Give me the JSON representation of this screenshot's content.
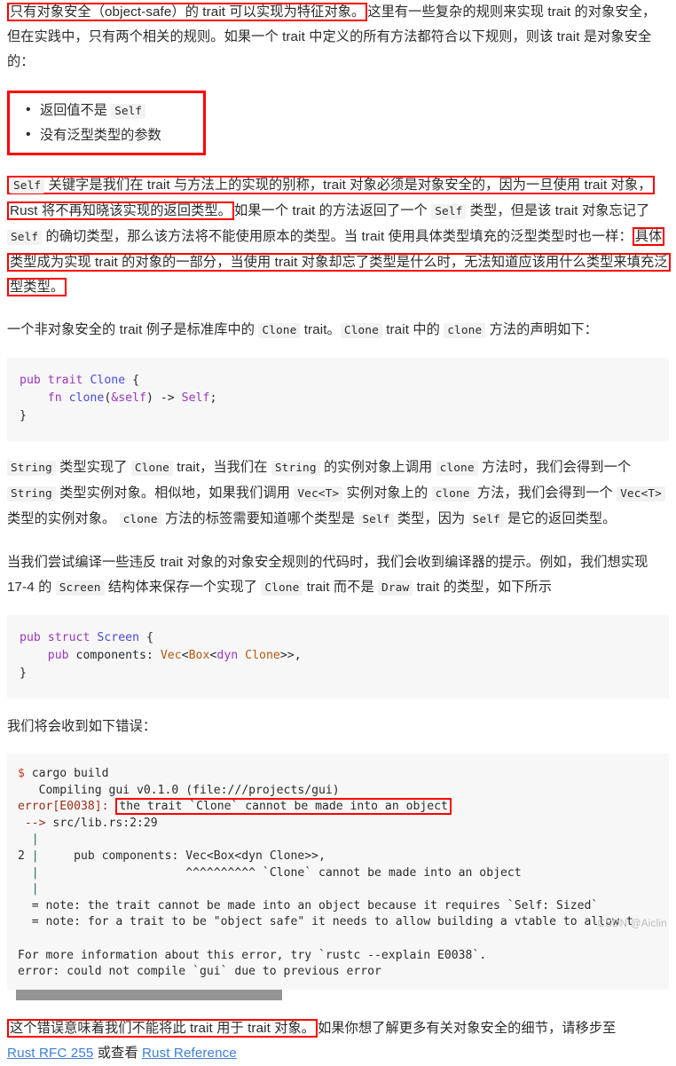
{
  "article": {
    "para1": {
      "highlighted": "只有对象安全（object-safe）的 trait 可以实现为特征对象。",
      "rest": "这里有一些复杂的规则来实现 trait 的对象安全，但在实践中，只有两个相关的规则。如果一个 trait 中定义的所有方法都符合以下规则，则该 trait 是对象安全的："
    },
    "rules": [
      {
        "before": "返回值不是 ",
        "code": "Self",
        "after": ""
      },
      {
        "before": "没有泛型类型的参数",
        "code": "",
        "after": ""
      }
    ],
    "para2": {
      "seg1_code": "Self",
      "seg1": " 关键字是我们在 trait 与方法上的实现的别称，trait 对象必须是对象安全的，因为一旦使用 trait 对象，Rust 将不再知晓该实现的返回类型。",
      "seg2_a": "如果一个 trait 的方法返回了一个 ",
      "seg2_code1": "Self",
      "seg2_b": " 类型，但是该 trait 对象忘记了 ",
      "seg2_code2": "Self",
      "seg2_c": " 的确切类型，那么该方法将不能使用原本的类型。当 trait 使用具体类型填充的泛型类型时也一样：",
      "seg3": "具体类型成为实现 trait 的对象的一部分，当使用 trait 对象却忘了类型是什么时，无法知道应该用什么类型来填充泛型类型。"
    },
    "para3": {
      "a": "一个非对象安全的 trait 例子是标准库中的 ",
      "code1": "Clone",
      "b": " trait。",
      "code2": "Clone",
      "c": " trait 中的 ",
      "code3": "clone",
      "d": " 方法的声明如下："
    },
    "code_clone": {
      "lines": [
        [
          {
            "t": "pub",
            "c": "k-purple"
          },
          {
            "t": " ",
            "c": "k-plain"
          },
          {
            "t": "trait",
            "c": "k-purple"
          },
          {
            "t": " ",
            "c": "k-plain"
          },
          {
            "t": "Clone",
            "c": "k-blue"
          },
          {
            "t": " {",
            "c": "k-plain"
          }
        ],
        [
          {
            "t": "    ",
            "c": "k-plain"
          },
          {
            "t": "fn",
            "c": "k-purple"
          },
          {
            "t": " ",
            "c": "k-plain"
          },
          {
            "t": "clone",
            "c": "k-blue"
          },
          {
            "t": "(",
            "c": "k-plain"
          },
          {
            "t": "&self",
            "c": "k-purple"
          },
          {
            "t": ") -> ",
            "c": "k-plain"
          },
          {
            "t": "Self",
            "c": "k-purple"
          },
          {
            "t": ";",
            "c": "k-plain"
          }
        ],
        [
          {
            "t": "}",
            "c": "k-plain"
          }
        ]
      ]
    },
    "para4": {
      "c1": "String",
      "a": " 类型实现了 ",
      "c2": "Clone",
      "b": " trait，当我们在 ",
      "c3": "String",
      "c": " 的实例对象上调用 ",
      "c4": "clone",
      "d": " 方法时，我们会得到一个 ",
      "c5": "String",
      "e": " 类型实例对象。相似地，如果我们调用 ",
      "c6": "Vec<T>",
      "f": " 实例对象上的 ",
      "c7": "clone",
      "g": " 方法，我们会得到一个 ",
      "c8": "Vec<T>",
      "h": " 类型的实例对象。 ",
      "c9": "clone",
      "i": " 方法的标签需要知道哪个类型是 ",
      "c10": "Self",
      "j": " 类型，因为 ",
      "c11": "Self",
      "k": " 是它的返回类型。"
    },
    "para5": {
      "a": "当我们尝试编译一些违反 trait 对象的对象安全规则的代码时，我们会收到编译器的提示。例如，我们想实现 17-4 的 ",
      "c1": "Screen",
      "b": " 结构体来保存一个实现了 ",
      "c2": "Clone",
      "c": " trait 而不是 ",
      "c3": "Draw",
      "d": " trait 的类型，如下所示"
    },
    "code_screen": {
      "lines": [
        [
          {
            "t": "pub",
            "c": "k-purple"
          },
          {
            "t": " ",
            "c": "k-plain"
          },
          {
            "t": "struct",
            "c": "k-purple"
          },
          {
            "t": " ",
            "c": "k-plain"
          },
          {
            "t": "Screen",
            "c": "k-blue"
          },
          {
            "t": " {",
            "c": "k-plain"
          }
        ],
        [
          {
            "t": "    ",
            "c": "k-plain"
          },
          {
            "t": "pub",
            "c": "k-purple"
          },
          {
            "t": " components: ",
            "c": "k-plain"
          },
          {
            "t": "Vec",
            "c": "k-orange"
          },
          {
            "t": "<",
            "c": "k-plain"
          },
          {
            "t": "Box",
            "c": "k-orange"
          },
          {
            "t": "<",
            "c": "k-plain"
          },
          {
            "t": "dyn",
            "c": "k-purple"
          },
          {
            "t": " ",
            "c": "k-plain"
          },
          {
            "t": "Clone",
            "c": "k-orange"
          },
          {
            "t": ">>,",
            "c": "k-plain"
          }
        ],
        [
          {
            "t": "}",
            "c": "k-plain"
          }
        ]
      ]
    },
    "para6": "我们将会收到如下错误：",
    "terminal": {
      "lines": [
        [
          {
            "t": "$",
            "c": "t-red"
          },
          {
            "t": " cargo build",
            "c": "t-plain"
          }
        ],
        [
          {
            "t": "   Compiling gui v0.1.0 (file:///projects/gui)",
            "c": "t-plain"
          }
        ],
        [
          {
            "t": "error[E0038]:",
            "c": "t-maroon"
          },
          {
            "t": " ",
            "c": "t-plain"
          },
          {
            "t": "the trait `Clone` cannot be made into an object",
            "c": "t-plain",
            "hl": true
          }
        ],
        [
          {
            "t": " ",
            "c": "t-plain"
          },
          {
            "t": "-->",
            "c": "t-maroon"
          },
          {
            "t": " src/lib.rs:2:29",
            "c": "t-plain"
          }
        ],
        [
          {
            "t": "  ",
            "c": "t-plain"
          },
          {
            "t": "|",
            "c": "t-teal"
          }
        ],
        [
          {
            "t": "2 ",
            "c": "t-plain"
          },
          {
            "t": "|",
            "c": "t-teal"
          },
          {
            "t": "     pub components: Vec<Box<dyn Clone>>,",
            "c": "t-plain"
          }
        ],
        [
          {
            "t": "  ",
            "c": "t-plain"
          },
          {
            "t": "|",
            "c": "t-teal"
          },
          {
            "t": "                     ^^^^^^^^^^ `Clone` cannot be made into an object",
            "c": "t-plain"
          }
        ],
        [
          {
            "t": "  ",
            "c": "t-plain"
          },
          {
            "t": "|",
            "c": "t-teal"
          }
        ],
        [
          {
            "t": "  = note: the trait cannot be made into an object because it requires `Self: Sized`",
            "c": "t-plain"
          }
        ],
        [
          {
            "t": "  = note: for a trait to be \"object safe\" it needs to allow building a vtable to allow t",
            "c": "t-plain"
          }
        ],
        [
          {
            "t": "",
            "c": "t-plain"
          }
        ],
        [
          {
            "t": "For more information about this error, try `rustc --explain E0038`.",
            "c": "t-plain"
          }
        ],
        [
          {
            "t": "error: could not compile `gui` due to previous error",
            "c": "t-plain"
          }
        ]
      ]
    },
    "para7": {
      "highlighted": "这个错误意味着我们不能将此 trait 用于 trait 对象。",
      "rest": "如果你想了解更多有关对象安全的细节，请移步至",
      "link1": "Rust RFC 255",
      "mid": " 或查看 ",
      "link2": "Rust Reference"
    }
  },
  "watermark": "CSDN @Aiclin",
  "colors": {
    "highlight_border": "#ff0000",
    "link": "#3e7fd4",
    "code_bg": "#f7f7f7",
    "chip_bg": "#f2f2f2",
    "scrollbar_thumb": "#949494"
  }
}
